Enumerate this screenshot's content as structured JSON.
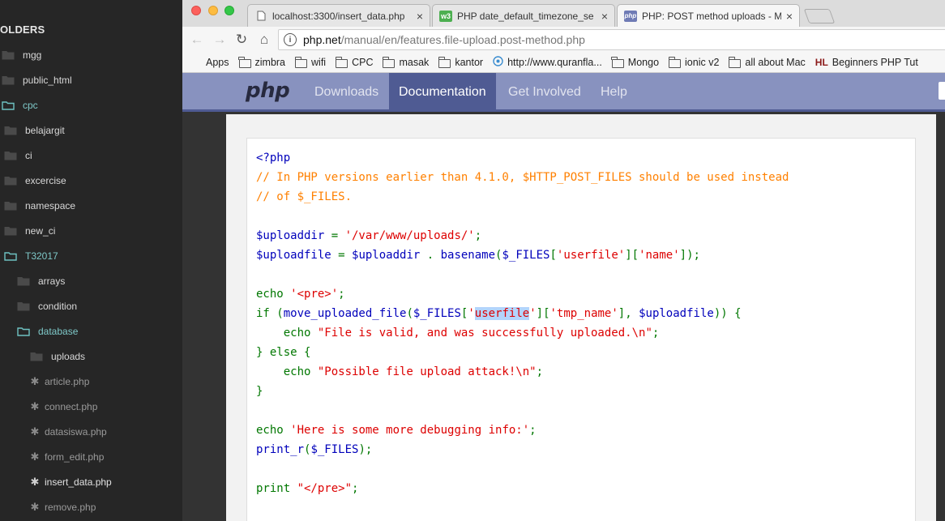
{
  "sidebar": {
    "heading": "OLDERS",
    "items": [
      {
        "label": "mgg",
        "kind": "folder",
        "indent": 0
      },
      {
        "label": "public_html",
        "kind": "folder",
        "indent": 0
      },
      {
        "label": "cpc",
        "kind": "folder-open",
        "indent": 0
      },
      {
        "label": "belajargit",
        "kind": "folder",
        "indent": 1
      },
      {
        "label": "ci",
        "kind": "folder",
        "indent": 1
      },
      {
        "label": "excercise",
        "kind": "folder",
        "indent": 1
      },
      {
        "label": "namespace",
        "kind": "folder",
        "indent": 1
      },
      {
        "label": "new_ci",
        "kind": "folder",
        "indent": 1
      },
      {
        "label": "T32017",
        "kind": "folder-open",
        "indent": 1
      },
      {
        "label": "arrays",
        "kind": "folder",
        "indent": 2
      },
      {
        "label": "condition",
        "kind": "folder",
        "indent": 2
      },
      {
        "label": "database",
        "kind": "folder-open",
        "indent": 2
      },
      {
        "label": "uploads",
        "kind": "folder",
        "indent": 3
      },
      {
        "label": "article.php",
        "kind": "file",
        "indent": 3
      },
      {
        "label": "connect.php",
        "kind": "file",
        "indent": 3
      },
      {
        "label": "datasiswa.php",
        "kind": "file",
        "indent": 3
      },
      {
        "label": "form_edit.php",
        "kind": "file",
        "indent": 3
      },
      {
        "label": "insert_data.php",
        "kind": "file-active",
        "indent": 3
      },
      {
        "label": "remove.php",
        "kind": "file",
        "indent": 3
      }
    ]
  },
  "browser": {
    "tabs": [
      {
        "title": "localhost:3300/insert_data.php",
        "close": "×",
        "icon": "page-icon"
      },
      {
        "title": "PHP date_default_timezone_se",
        "close": "×",
        "icon": "w3schools-icon",
        "icon_text": "w3"
      },
      {
        "title": "PHP: POST method uploads - Manual",
        "close": "×",
        "icon": "php-icon",
        "icon_text": "php",
        "active": true
      }
    ],
    "nav": {
      "back": "←",
      "forward": "→",
      "reload": "↻",
      "home": "⌂"
    },
    "address": {
      "host": "php.net",
      "path": "/manual/en/features.file-upload.post-method.php"
    },
    "bookmarks": [
      {
        "label": "Apps",
        "icon": "apps-icon"
      },
      {
        "label": "zimbra",
        "icon": "folder-icon"
      },
      {
        "label": "wifi",
        "icon": "folder-icon"
      },
      {
        "label": "CPC",
        "icon": "folder-icon"
      },
      {
        "label": "masak",
        "icon": "folder-icon"
      },
      {
        "label": "kantor",
        "icon": "folder-icon"
      },
      {
        "label": "http://www.quranfla...",
        "icon": "globe-icon"
      },
      {
        "label": "Mongo",
        "icon": "folder-icon"
      },
      {
        "label": "ionic v2",
        "icon": "folder-icon"
      },
      {
        "label": "all about Mac",
        "icon": "folder-icon"
      },
      {
        "label": "Beginners PHP Tut",
        "icon": "hl-icon",
        "icon_text": "HL"
      }
    ]
  },
  "php_site": {
    "logo": "php",
    "nav": [
      "Downloads",
      "Documentation",
      "Get Involved",
      "Help"
    ],
    "active_nav": "Documentation"
  },
  "code": {
    "lines": [
      [
        [
          "v",
          "<?php"
        ]
      ],
      [
        [
          "c",
          "// In PHP versions earlier than 4.1.0, $HTTP_POST_FILES should be used instead"
        ]
      ],
      [
        [
          "c",
          "// of $_FILES."
        ]
      ],
      [],
      [
        [
          "v",
          "$uploaddir "
        ],
        [
          "k",
          "= "
        ],
        [
          "s",
          "'/var/www/uploads/'"
        ],
        [
          "k",
          ";"
        ]
      ],
      [
        [
          "v",
          "$uploadfile "
        ],
        [
          "k",
          "= "
        ],
        [
          "v",
          "$uploaddir "
        ],
        [
          "k",
          ". "
        ],
        [
          "v",
          "basename"
        ],
        [
          "k",
          "("
        ],
        [
          "v",
          "$_FILES"
        ],
        [
          "k",
          "["
        ],
        [
          "s",
          "'userfile'"
        ],
        [
          "k",
          "]["
        ],
        [
          "s",
          "'name'"
        ],
        [
          "k",
          "]);"
        ]
      ],
      [],
      [
        [
          "k",
          "echo "
        ],
        [
          "s",
          "'<pre>'"
        ],
        [
          "k",
          ";"
        ]
      ],
      [
        [
          "k",
          "if ("
        ],
        [
          "v",
          "move_uploaded_file"
        ],
        [
          "k",
          "("
        ],
        [
          "v",
          "$_FILES"
        ],
        [
          "k",
          "["
        ],
        [
          "s",
          "'"
        ],
        [
          "s hl",
          "userfile"
        ],
        [
          "s",
          "'"
        ],
        [
          "k",
          "]["
        ],
        [
          "s",
          "'tmp_name'"
        ],
        [
          "k",
          "], "
        ],
        [
          "v",
          "$uploadfile"
        ],
        [
          "k",
          ")) {"
        ]
      ],
      [
        [
          "k",
          "    echo "
        ],
        [
          "s",
          "\"File is valid, and was successfully uploaded.\\n\""
        ],
        [
          "k",
          ";"
        ]
      ],
      [
        [
          "k",
          "} else {"
        ]
      ],
      [
        [
          "k",
          "    echo "
        ],
        [
          "s",
          "\"Possible file upload attack!\\n\""
        ],
        [
          "k",
          ";"
        ]
      ],
      [
        [
          "k",
          "}"
        ]
      ],
      [],
      [
        [
          "k",
          "echo "
        ],
        [
          "s",
          "'Here is some more debugging info:'"
        ],
        [
          "k",
          ";"
        ]
      ],
      [
        [
          "v",
          "print_r"
        ],
        [
          "k",
          "("
        ],
        [
          "v",
          "$_FILES"
        ],
        [
          "k",
          ");"
        ]
      ],
      [],
      [
        [
          "k",
          "print "
        ],
        [
          "s",
          "\"</pre>\""
        ],
        [
          "k",
          ";"
        ]
      ]
    ]
  },
  "colors": {
    "sidebar_bg": "#262626",
    "php_nav": "#8892bf",
    "php_nav_active": "#4f5b93",
    "code_keyword": "#007700",
    "code_comment": "#ff8000",
    "code_string": "#dd0000",
    "code_default": "#0000bb"
  }
}
